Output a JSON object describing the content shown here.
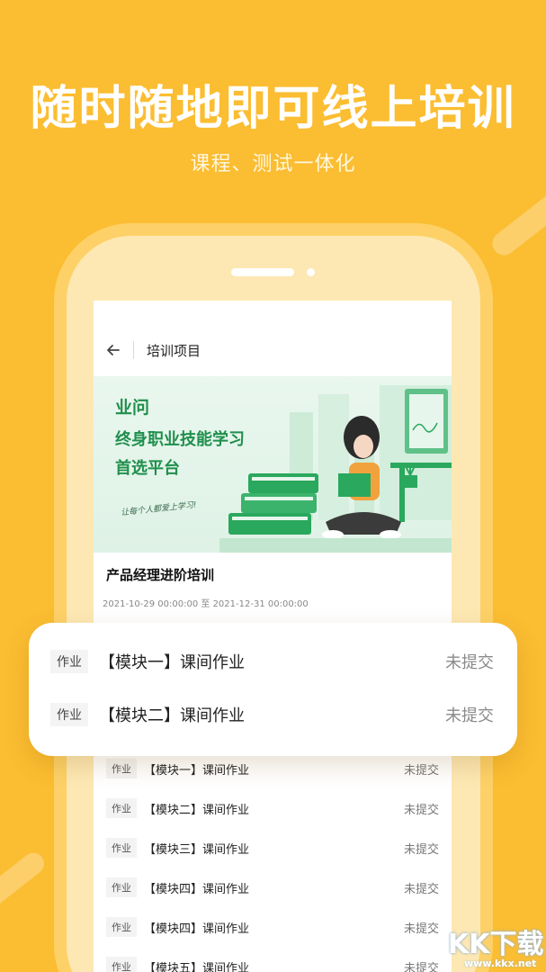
{
  "hero": {
    "title": "随时随地即可线上培训",
    "subtitle": "课程、测试一体化"
  },
  "screen": {
    "nav_title": "培训项目",
    "banner": {
      "brand": "业问",
      "slogan_line1": "终身职业技能学习",
      "slogan_line2": "首选平台",
      "handwritten_note": "让每个人都爱上学习!",
      "accent_color": "#2aa85d"
    },
    "course": {
      "title": "产品经理进阶培训",
      "date_range": "2021-10-29 00:00:00 至 2021-12-31 00:00:00"
    },
    "list": [
      {
        "tag": "作业",
        "name": "【模块一】课间作业",
        "status": "未提交"
      },
      {
        "tag": "作业",
        "name": "【模块二】课间作业",
        "status": "未提交"
      },
      {
        "tag": "作业",
        "name": "【模块三】课间作业",
        "status": "未提交"
      },
      {
        "tag": "作业",
        "name": "【模块四】课间作业",
        "status": "未提交"
      },
      {
        "tag": "作业",
        "name": "【模块四】课间作业",
        "status": "未提交"
      },
      {
        "tag": "作业",
        "name": "【模块五】课间作业",
        "status": "未提交"
      }
    ]
  },
  "card": [
    {
      "tag": "作业",
      "name": "【模块一】课间作业",
      "status": "未提交"
    },
    {
      "tag": "作业",
      "name": "【模块二】课间作业",
      "status": "未提交"
    }
  ],
  "watermark": {
    "text": "KK下载",
    "url": "www.kkx.net"
  },
  "colors": {
    "background": "#fbbd31",
    "phone_frame": "#fde8b3",
    "brand_green": "#1f8f4c"
  }
}
